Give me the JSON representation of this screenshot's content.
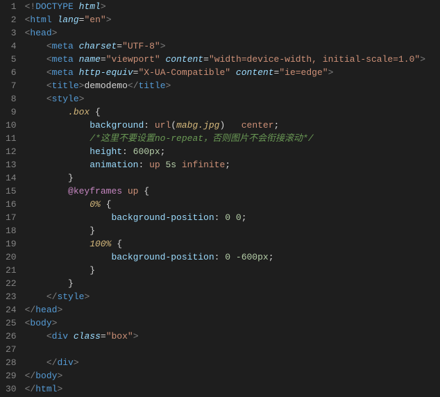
{
  "lines": [
    {
      "n": 1,
      "indent": 0,
      "tokens": [
        [
          "gray",
          "<!"
        ],
        [
          "tag",
          "DOCTYPE "
        ],
        [
          "attr",
          "html"
        ],
        [
          "gray",
          ">"
        ]
      ]
    },
    {
      "n": 2,
      "indent": 0,
      "tokens": [
        [
          "gray",
          "<"
        ],
        [
          "tag",
          "html "
        ],
        [
          "attr",
          "lang"
        ],
        [
          "punct",
          "="
        ],
        [
          "string",
          "\"en\""
        ],
        [
          "gray",
          ">"
        ]
      ]
    },
    {
      "n": 3,
      "indent": 0,
      "tokens": [
        [
          "gray",
          "<"
        ],
        [
          "tag",
          "head"
        ],
        [
          "gray",
          ">"
        ]
      ]
    },
    {
      "n": 4,
      "indent": 1,
      "tokens": [
        [
          "gray",
          "<"
        ],
        [
          "tag",
          "meta "
        ],
        [
          "attr",
          "charset"
        ],
        [
          "punct",
          "="
        ],
        [
          "string",
          "\"UTF-8\""
        ],
        [
          "gray",
          ">"
        ]
      ]
    },
    {
      "n": 5,
      "indent": 1,
      "tokens": [
        [
          "gray",
          "<"
        ],
        [
          "tag",
          "meta "
        ],
        [
          "attr",
          "name"
        ],
        [
          "punct",
          "="
        ],
        [
          "string",
          "\"viewport\""
        ],
        [
          "attr",
          " content"
        ],
        [
          "punct",
          "="
        ],
        [
          "string",
          "\"width=device-width, initial-scale=1.0\""
        ],
        [
          "gray",
          ">"
        ]
      ]
    },
    {
      "n": 6,
      "indent": 1,
      "tokens": [
        [
          "gray",
          "<"
        ],
        [
          "tag",
          "meta "
        ],
        [
          "attr",
          "http-equiv"
        ],
        [
          "punct",
          "="
        ],
        [
          "string",
          "\"X-UA-Compatible\""
        ],
        [
          "attr",
          " content"
        ],
        [
          "punct",
          "="
        ],
        [
          "string",
          "\"ie=edge\""
        ],
        [
          "gray",
          ">"
        ]
      ]
    },
    {
      "n": 7,
      "indent": 1,
      "tokens": [
        [
          "gray",
          "<"
        ],
        [
          "tag",
          "title"
        ],
        [
          "gray",
          ">"
        ],
        [
          "text",
          "demodemo"
        ],
        [
          "gray",
          "</"
        ],
        [
          "tag",
          "title"
        ],
        [
          "gray",
          ">"
        ]
      ]
    },
    {
      "n": 8,
      "indent": 1,
      "tokens": [
        [
          "gray",
          "<"
        ],
        [
          "tag",
          "style"
        ],
        [
          "gray",
          ">"
        ]
      ]
    },
    {
      "n": 9,
      "indent": 2,
      "tokens": [
        [
          "sel",
          ".box"
        ],
        [
          "white",
          " {"
        ]
      ]
    },
    {
      "n": 10,
      "indent": 3,
      "tokens": [
        [
          "prop",
          "background"
        ],
        [
          "white",
          ": "
        ],
        [
          "val",
          "url"
        ],
        [
          "white",
          "("
        ],
        [
          "sel",
          "mabg.jpg"
        ],
        [
          "white",
          ")   "
        ],
        [
          "val",
          "center"
        ],
        [
          "white",
          ";"
        ]
      ]
    },
    {
      "n": 11,
      "indent": 3,
      "tokens": [
        [
          "comment",
          "/*这里不要设置no-repeat，否则图片不会衔接滚动*/"
        ]
      ]
    },
    {
      "n": 12,
      "indent": 3,
      "tokens": [
        [
          "prop",
          "height"
        ],
        [
          "white",
          ": "
        ],
        [
          "num",
          "600px"
        ],
        [
          "white",
          ";"
        ]
      ]
    },
    {
      "n": 13,
      "indent": 3,
      "tokens": [
        [
          "prop",
          "animation"
        ],
        [
          "white",
          ": "
        ],
        [
          "val",
          "up "
        ],
        [
          "num",
          "5s"
        ],
        [
          "val",
          " infinite"
        ],
        [
          "white",
          ";"
        ]
      ]
    },
    {
      "n": 14,
      "indent": 2,
      "tokens": [
        [
          "white",
          "}"
        ]
      ]
    },
    {
      "n": 15,
      "indent": 2,
      "tokens": [
        [
          "atrule",
          "@keyframes"
        ],
        [
          "val",
          " up "
        ],
        [
          "white",
          "{"
        ]
      ]
    },
    {
      "n": 16,
      "indent": 3,
      "tokens": [
        [
          "sel",
          "0%"
        ],
        [
          "white",
          " {"
        ]
      ]
    },
    {
      "n": 17,
      "indent": 4,
      "tokens": [
        [
          "prop",
          "background-position"
        ],
        [
          "white",
          ": "
        ],
        [
          "num",
          "0"
        ],
        [
          "white",
          " "
        ],
        [
          "num",
          "0"
        ],
        [
          "white",
          ";"
        ]
      ]
    },
    {
      "n": 18,
      "indent": 3,
      "tokens": [
        [
          "white",
          "}"
        ]
      ]
    },
    {
      "n": 19,
      "indent": 3,
      "tokens": [
        [
          "sel",
          "100%"
        ],
        [
          "white",
          " {"
        ]
      ]
    },
    {
      "n": 20,
      "indent": 4,
      "tokens": [
        [
          "prop",
          "background-position"
        ],
        [
          "white",
          ": "
        ],
        [
          "num",
          "0"
        ],
        [
          "white",
          " "
        ],
        [
          "num",
          "-600px"
        ],
        [
          "white",
          ";"
        ]
      ]
    },
    {
      "n": 21,
      "indent": 3,
      "tokens": [
        [
          "white",
          "}"
        ]
      ]
    },
    {
      "n": 22,
      "indent": 2,
      "tokens": [
        [
          "white",
          "}"
        ]
      ]
    },
    {
      "n": 23,
      "indent": 1,
      "tokens": [
        [
          "gray",
          "</"
        ],
        [
          "tag",
          "style"
        ],
        [
          "gray",
          ">"
        ]
      ]
    },
    {
      "n": 24,
      "indent": 0,
      "tokens": [
        [
          "gray",
          "</"
        ],
        [
          "tag",
          "head"
        ],
        [
          "gray",
          ">"
        ]
      ]
    },
    {
      "n": 25,
      "indent": 0,
      "tokens": [
        [
          "gray",
          "<"
        ],
        [
          "tag",
          "body"
        ],
        [
          "gray",
          ">"
        ]
      ]
    },
    {
      "n": 26,
      "indent": 1,
      "tokens": [
        [
          "gray",
          "<"
        ],
        [
          "tag",
          "div "
        ],
        [
          "attr",
          "class"
        ],
        [
          "punct",
          "="
        ],
        [
          "string",
          "\"box\""
        ],
        [
          "gray",
          ">"
        ]
      ]
    },
    {
      "n": 27,
      "indent": 0,
      "tokens": []
    },
    {
      "n": 28,
      "indent": 1,
      "tokens": [
        [
          "gray",
          "</"
        ],
        [
          "tag",
          "div"
        ],
        [
          "gray",
          ">"
        ]
      ]
    },
    {
      "n": 29,
      "indent": 0,
      "tokens": [
        [
          "gray",
          "</"
        ],
        [
          "tag",
          "body"
        ],
        [
          "gray",
          ">"
        ]
      ]
    },
    {
      "n": 30,
      "indent": 0,
      "tokens": [
        [
          "gray",
          "</"
        ],
        [
          "tag",
          "html"
        ],
        [
          "gray",
          ">"
        ]
      ]
    }
  ],
  "indentUnit": "    "
}
